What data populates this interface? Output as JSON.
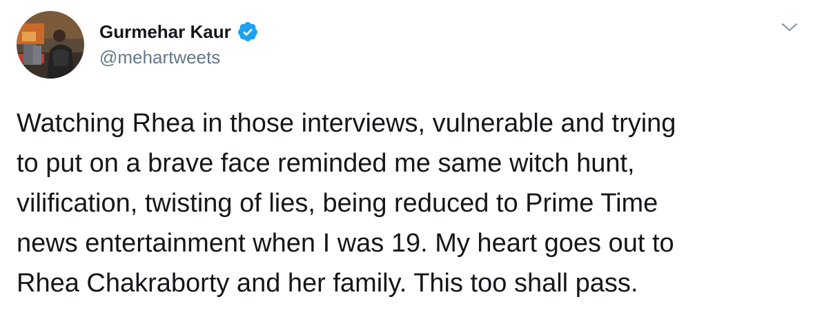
{
  "author": {
    "display_name": "Gurmehar Kaur",
    "handle": "@mehartweets",
    "verified": true,
    "avatar_icon": "user-avatar-photo",
    "verified_icon": "verified-badge-icon"
  },
  "menu": {
    "icon": "chevron-down-icon"
  },
  "tweet": {
    "lines": [
      "Watching Rhea in those interviews, vulnerable and trying",
      "to put on a brave face reminded me same witch hunt,",
      "vilification, twisting of lies, being reduced to Prime Time",
      "news entertainment when I was 19. My heart goes out to",
      "Rhea Chakraborty and her family. This too shall pass."
    ]
  },
  "colors": {
    "verified_blue": "#1da1f2",
    "handle_gray": "#657786",
    "text": "#14171a",
    "caret_gray": "#8899a6"
  }
}
